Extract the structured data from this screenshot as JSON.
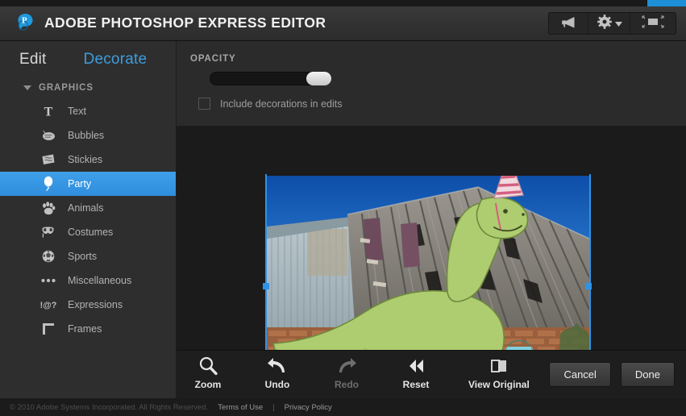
{
  "window": {
    "title": "ADOBE PHOTOSHOP EXPRESS EDITOR",
    "logo_icon": "photoshop-express-logo"
  },
  "header": {
    "tools": [
      {
        "name": "feedback-megaphone-icon",
        "label": "Feedback"
      },
      {
        "name": "settings-gear-icon",
        "label": "Settings"
      },
      {
        "name": "fullscreen-expand-icon",
        "label": "Fullscreen"
      }
    ]
  },
  "sidebar": {
    "tabs": [
      {
        "label": "Edit",
        "active": false
      },
      {
        "label": "Decorate",
        "active": true
      }
    ],
    "section": {
      "title": "GRAPHICS",
      "expanded": true
    },
    "items": [
      {
        "label": "Text",
        "icon": "text-t-icon",
        "selected": false
      },
      {
        "label": "Bubbles",
        "icon": "speech-bubble-icon",
        "selected": false
      },
      {
        "label": "Stickies",
        "icon": "sticky-note-icon",
        "selected": false
      },
      {
        "label": "Party",
        "icon": "balloon-icon",
        "selected": true
      },
      {
        "label": "Animals",
        "icon": "paw-print-icon",
        "selected": false
      },
      {
        "label": "Costumes",
        "icon": "mask-icon",
        "selected": false
      },
      {
        "label": "Sports",
        "icon": "soccer-ball-icon",
        "selected": false
      },
      {
        "label": "Miscellaneous",
        "icon": "ellipsis-dots-icon",
        "selected": false
      },
      {
        "label": "Expressions",
        "icon": "punctuation-icon",
        "selected": false
      },
      {
        "label": "Frames",
        "icon": "frame-corner-icon",
        "selected": false
      }
    ]
  },
  "main": {
    "opacity_label": "OPACITY",
    "opacity_value": 88,
    "checkbox": {
      "label": "Include decorations in edits",
      "checked": false
    }
  },
  "canvas": {
    "description": "Photograph of a weathered corrugated-metal and wood barn against a deep blue sky, with a cartoon green long-necked dinosaur sticker wearing a pink striped party hat overlaid in the foreground",
    "selection_active": true
  },
  "toolbar": {
    "items": [
      {
        "label": "Zoom",
        "icon": "magnifier-icon",
        "disabled": false
      },
      {
        "label": "Undo",
        "icon": "undo-arrow-icon",
        "disabled": false
      },
      {
        "label": "Redo",
        "icon": "redo-arrow-icon",
        "disabled": true
      },
      {
        "label": "Reset",
        "icon": "rewind-double-icon",
        "disabled": false
      },
      {
        "label": "View Original",
        "icon": "split-view-icon",
        "disabled": false
      }
    ],
    "cancel_label": "Cancel",
    "done_label": "Done"
  },
  "footer": {
    "copyright": "© 2010 Adobe Systems Incorporated. All Rights Reserved.",
    "terms_label": "Terms of Use",
    "separator": "|",
    "privacy_label": "Privacy Policy"
  },
  "colors": {
    "accent_blue": "#3d9de0",
    "selection_blue": "#2e93e6",
    "panel_bg": "#2e2e2e",
    "canvas_bg": "#1b1b1b"
  }
}
